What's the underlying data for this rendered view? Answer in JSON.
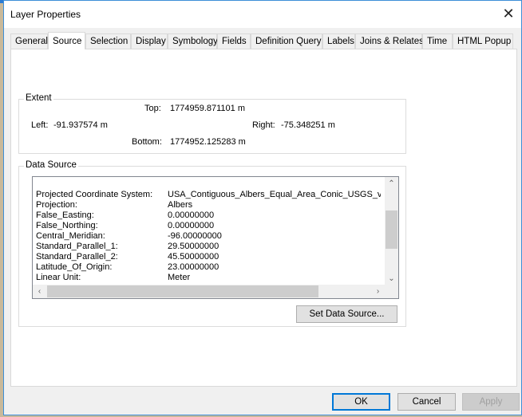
{
  "window": {
    "title": "Layer Properties",
    "close_icon": "close-icon"
  },
  "tabs": [
    {
      "label": "General",
      "active": false
    },
    {
      "label": "Source",
      "active": true
    },
    {
      "label": "Selection",
      "active": false
    },
    {
      "label": "Display",
      "active": false
    },
    {
      "label": "Symbology",
      "active": false
    },
    {
      "label": "Fields",
      "active": false
    },
    {
      "label": "Definition Query",
      "active": false
    },
    {
      "label": "Labels",
      "active": false
    },
    {
      "label": "Joins & Relates",
      "active": false
    },
    {
      "label": "Time",
      "active": false
    },
    {
      "label": "HTML Popup",
      "active": false
    }
  ],
  "extent": {
    "label": "Extent",
    "top_label": "Top:",
    "top_value": "1774959.871101 m",
    "left_label": "Left:",
    "left_value": "-91.937574 m",
    "right_label": "Right:",
    "right_value": "-75.348251 m",
    "bottom_label": "Bottom:",
    "bottom_value": "1774952.125283 m"
  },
  "data_source": {
    "label": "Data Source",
    "properties": [
      {
        "key": "Projected Coordinate System:",
        "value": "USA_Contiguous_Albers_Equal_Area_Conic_USGS_version"
      },
      {
        "key": "Projection:",
        "value": "Albers"
      },
      {
        "key": "False_Easting:",
        "value": "0.00000000"
      },
      {
        "key": "False_Northing:",
        "value": "0.00000000"
      },
      {
        "key": "Central_Meridian:",
        "value": "-96.00000000"
      },
      {
        "key": "Standard_Parallel_1:",
        "value": "29.50000000"
      },
      {
        "key": "Standard_Parallel_2:",
        "value": "45.50000000"
      },
      {
        "key": "Latitude_Of_Origin:",
        "value": "23.00000000"
      },
      {
        "key": "Linear Unit:",
        "value": "Meter"
      }
    ],
    "set_button": "Set Data Source..."
  },
  "buttons": {
    "ok": "OK",
    "cancel": "Cancel",
    "apply": "Apply"
  },
  "scroll_glyphs": {
    "up": "^",
    "down": "v",
    "left": "<",
    "right": ">"
  }
}
